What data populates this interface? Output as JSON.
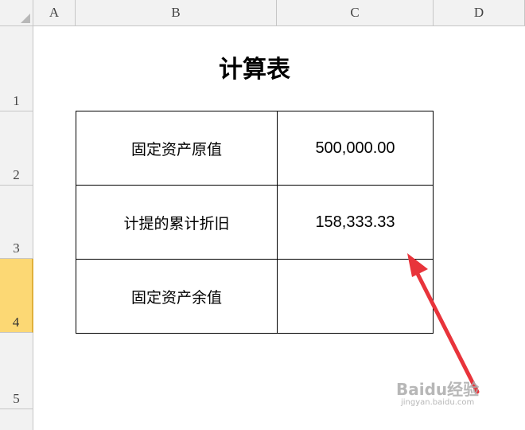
{
  "columns": [
    "A",
    "B",
    "C",
    "D"
  ],
  "rows": [
    "1",
    "2",
    "3",
    "4",
    "5"
  ],
  "title": "计算表",
  "table": [
    {
      "label": "固定资产原值",
      "value": "500,000.00"
    },
    {
      "label": "计提的累计折旧",
      "value": "158,333.33"
    },
    {
      "label": "固定资产余值",
      "value": ""
    }
  ],
  "selected_row": "4",
  "annotation": {
    "color": "#e8343b",
    "type": "arrow",
    "target": "C4"
  },
  "watermark": {
    "main": "Baidu经验",
    "sub": "jingyan.baidu.com"
  }
}
